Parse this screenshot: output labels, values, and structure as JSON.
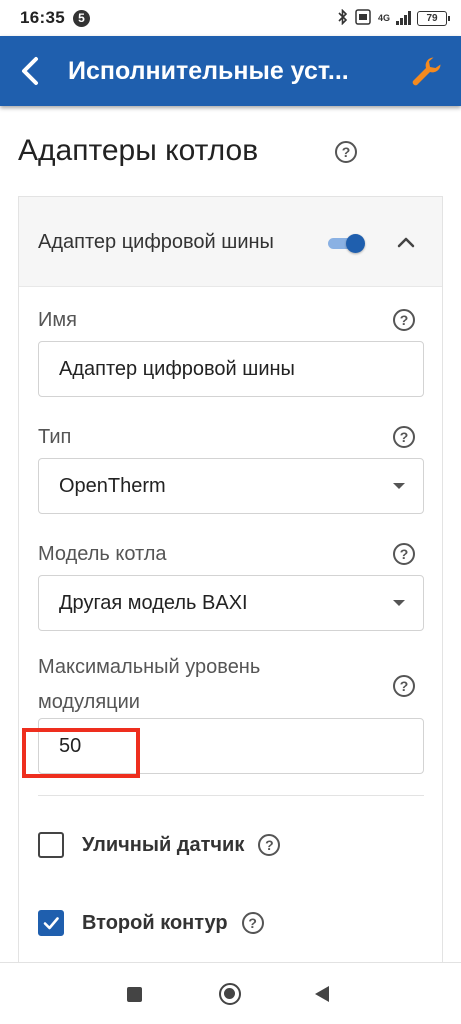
{
  "status_bar": {
    "time": "16:35",
    "notification_badge": "5",
    "network": "4G",
    "battery": "79"
  },
  "app_bar": {
    "title": "Исполнительные уст...",
    "accent_color": "#1f5fae",
    "wrench_color": "#f58a1f"
  },
  "page": {
    "title": "Адаптеры котлов",
    "help_glyph": "?"
  },
  "card": {
    "header_label": "Адаптер цифровой шины",
    "enabled": true,
    "fields": {
      "name": {
        "label": "Имя",
        "value": "Адаптер цифровой шины"
      },
      "type": {
        "label": "Тип",
        "value": "OpenTherm"
      },
      "model": {
        "label": "Модель котла",
        "value": "Другая модель BAXI"
      },
      "modulation": {
        "label_line1": "Максимальный уровень",
        "label_line2": "модуляции",
        "value": "50"
      }
    },
    "checkboxes": [
      {
        "label": "Уличный датчик",
        "checked": false
      },
      {
        "label": "Второй контур",
        "checked": true
      }
    ]
  },
  "highlight_color": "#ee2e1e"
}
